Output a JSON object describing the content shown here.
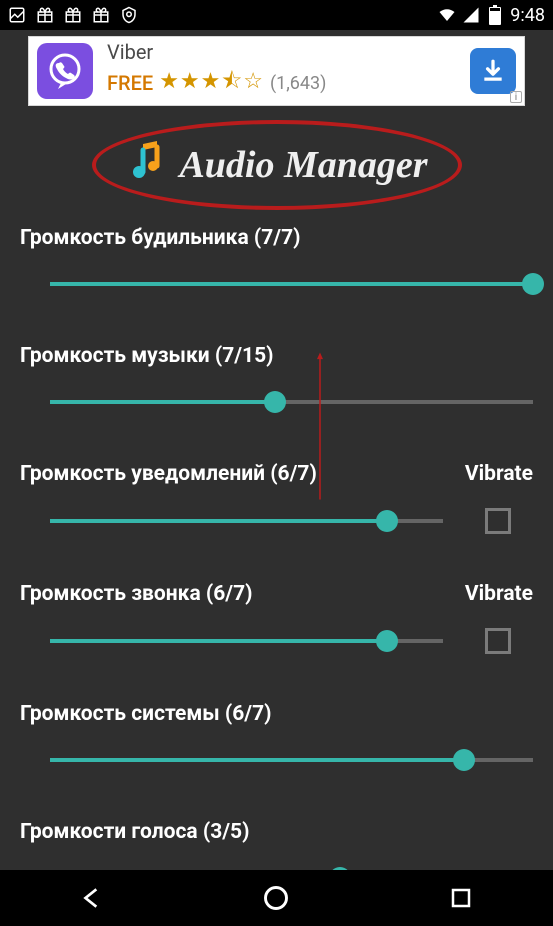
{
  "status": {
    "time": "9:48"
  },
  "ad": {
    "title": "Viber",
    "free_label": "FREE",
    "stars": "★★★⯪☆",
    "count": "(1,643)"
  },
  "app": {
    "title": "Audio Manager"
  },
  "controls": [
    {
      "label": "Громкость будильника (7/7)",
      "value": 7,
      "max": 7,
      "show_vibrate": false
    },
    {
      "label": "Громкость музыки (7/15)",
      "value": 7,
      "max": 15,
      "show_vibrate": false
    },
    {
      "label": "Громкость уведомлений (6/7)",
      "value": 6,
      "max": 7,
      "show_vibrate": true,
      "vibrate_label": "Vibrate"
    },
    {
      "label": "Громкость звонка (6/7)",
      "value": 6,
      "max": 7,
      "show_vibrate": true,
      "vibrate_label": "Vibrate"
    },
    {
      "label": "Громкость системы (6/7)",
      "value": 6,
      "max": 7,
      "show_vibrate": false
    },
    {
      "label": "Громкости голоса (3/5)",
      "value": 3,
      "max": 5,
      "show_vibrate": false
    }
  ]
}
